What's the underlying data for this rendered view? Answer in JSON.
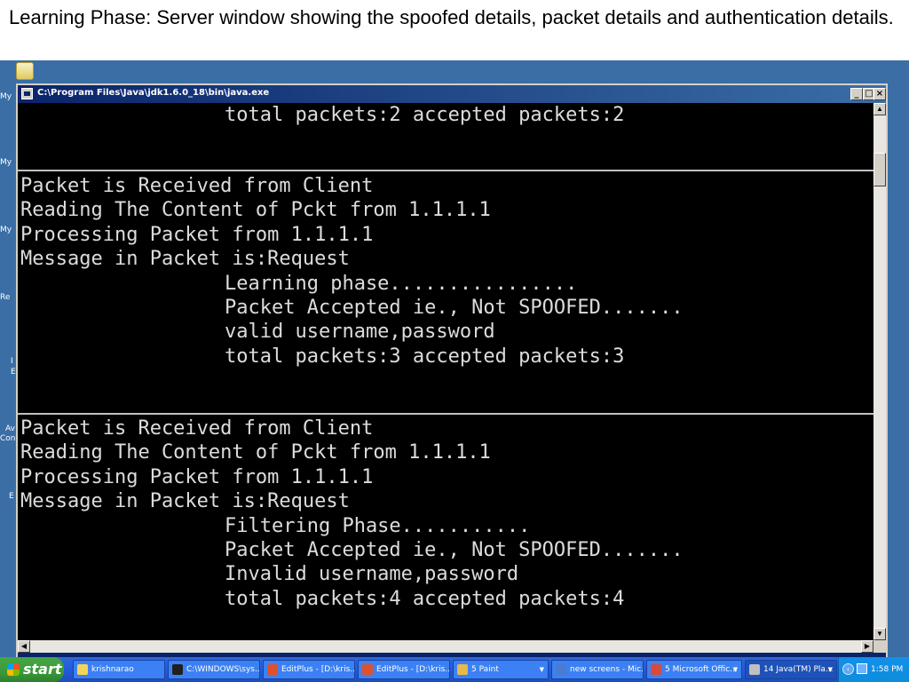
{
  "slide": {
    "caption": "Learning Phase: Server window showing the spoofed details, packet details and authentication details."
  },
  "desktop": {
    "icon_labels": [
      "My",
      "My",
      "My",
      "Re",
      "I",
      "E",
      "Av",
      "Con",
      "E"
    ]
  },
  "window": {
    "title": "C:\\Program Files\\Java\\jdk1.6.0_18\\bin\\java.exe",
    "minimize_glyph": "_",
    "maximize_glyph": "□",
    "close_glyph": "×"
  },
  "console": {
    "block0": [
      "total packets:2 accepted packets:2"
    ],
    "block1": [
      "Packet is Received from Client",
      "Reading The Content of Pckt from 1.1.1.1",
      "Processing Packet from 1.1.1.1",
      "Message in Packet is:Request",
      "Learning phase................",
      "Packet Accepted ie., Not SPOOFED.......",
      "valid username,password",
      "total packets:3 accepted packets:3"
    ],
    "block2": [
      "Packet is Received from Client",
      "Reading The Content of Pckt from 1.1.1.1",
      "Processing Packet from 1.1.1.1",
      "Message in Packet is:Request",
      "Filtering Phase...........",
      "Packet Accepted ie., Not SPOOFED.......",
      "Invalid username,password",
      "total packets:4 accepted packets:4"
    ]
  },
  "taskbar": {
    "start_label": "start",
    "buttons": [
      {
        "label": "krishnarao",
        "icon_color": "#f4d45a"
      },
      {
        "label": "C:\\WINDOWS\\sys...",
        "icon_color": "#202020"
      },
      {
        "label": "EditPlus - [D:\\kris...",
        "icon_color": "#e0502a"
      },
      {
        "label": "EditPlus - [D:\\kris...",
        "icon_color": "#e0502a"
      },
      {
        "label": "5 Paint",
        "icon_color": "#e8b84a"
      },
      {
        "label": "new screens - Mic...",
        "icon_color": "#4a7bd0"
      },
      {
        "label": "5 Microsoft Offic...",
        "icon_color": "#d84a3a"
      },
      {
        "label": "14 Java(TM) Pla...",
        "icon_color": "#c0c0c0"
      }
    ],
    "clock": "1:58 PM"
  }
}
